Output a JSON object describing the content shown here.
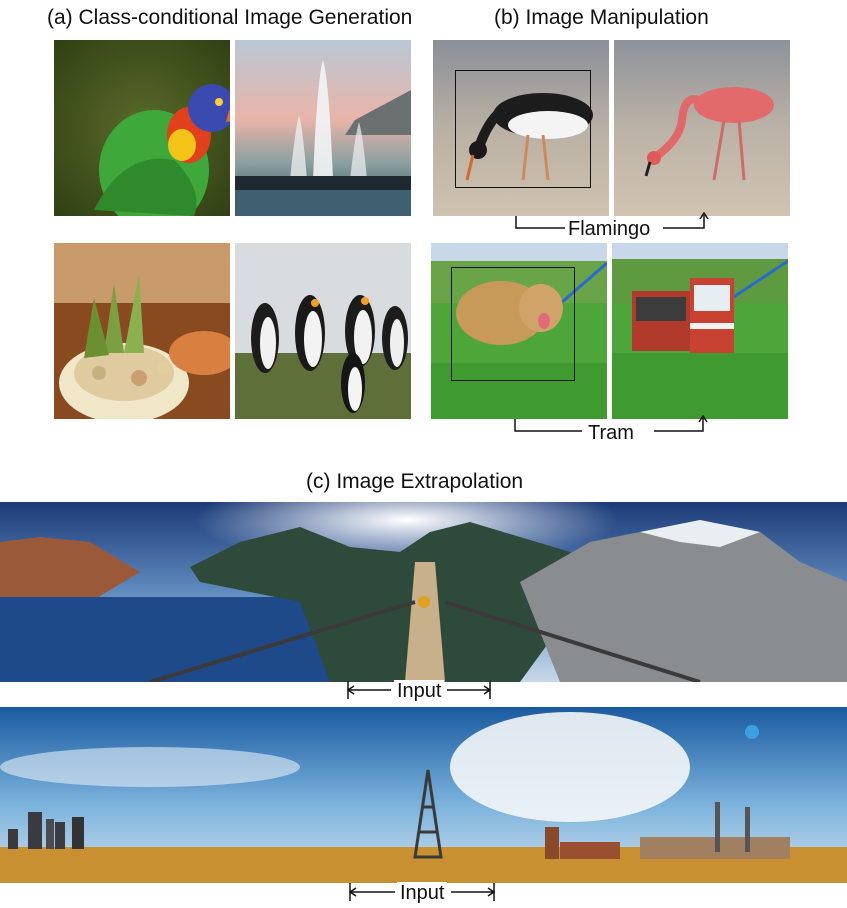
{
  "sections": {
    "a_title": "(a) Class-conditional Image Generation",
    "b_title": "(b) Image Manipulation",
    "c_title": "(c) Image Extrapolation"
  },
  "manipulation": {
    "row1_label": "Flamingo",
    "row2_label": "Tram"
  },
  "extrapolation": {
    "row1_label": "Input",
    "row2_label": "Input"
  }
}
